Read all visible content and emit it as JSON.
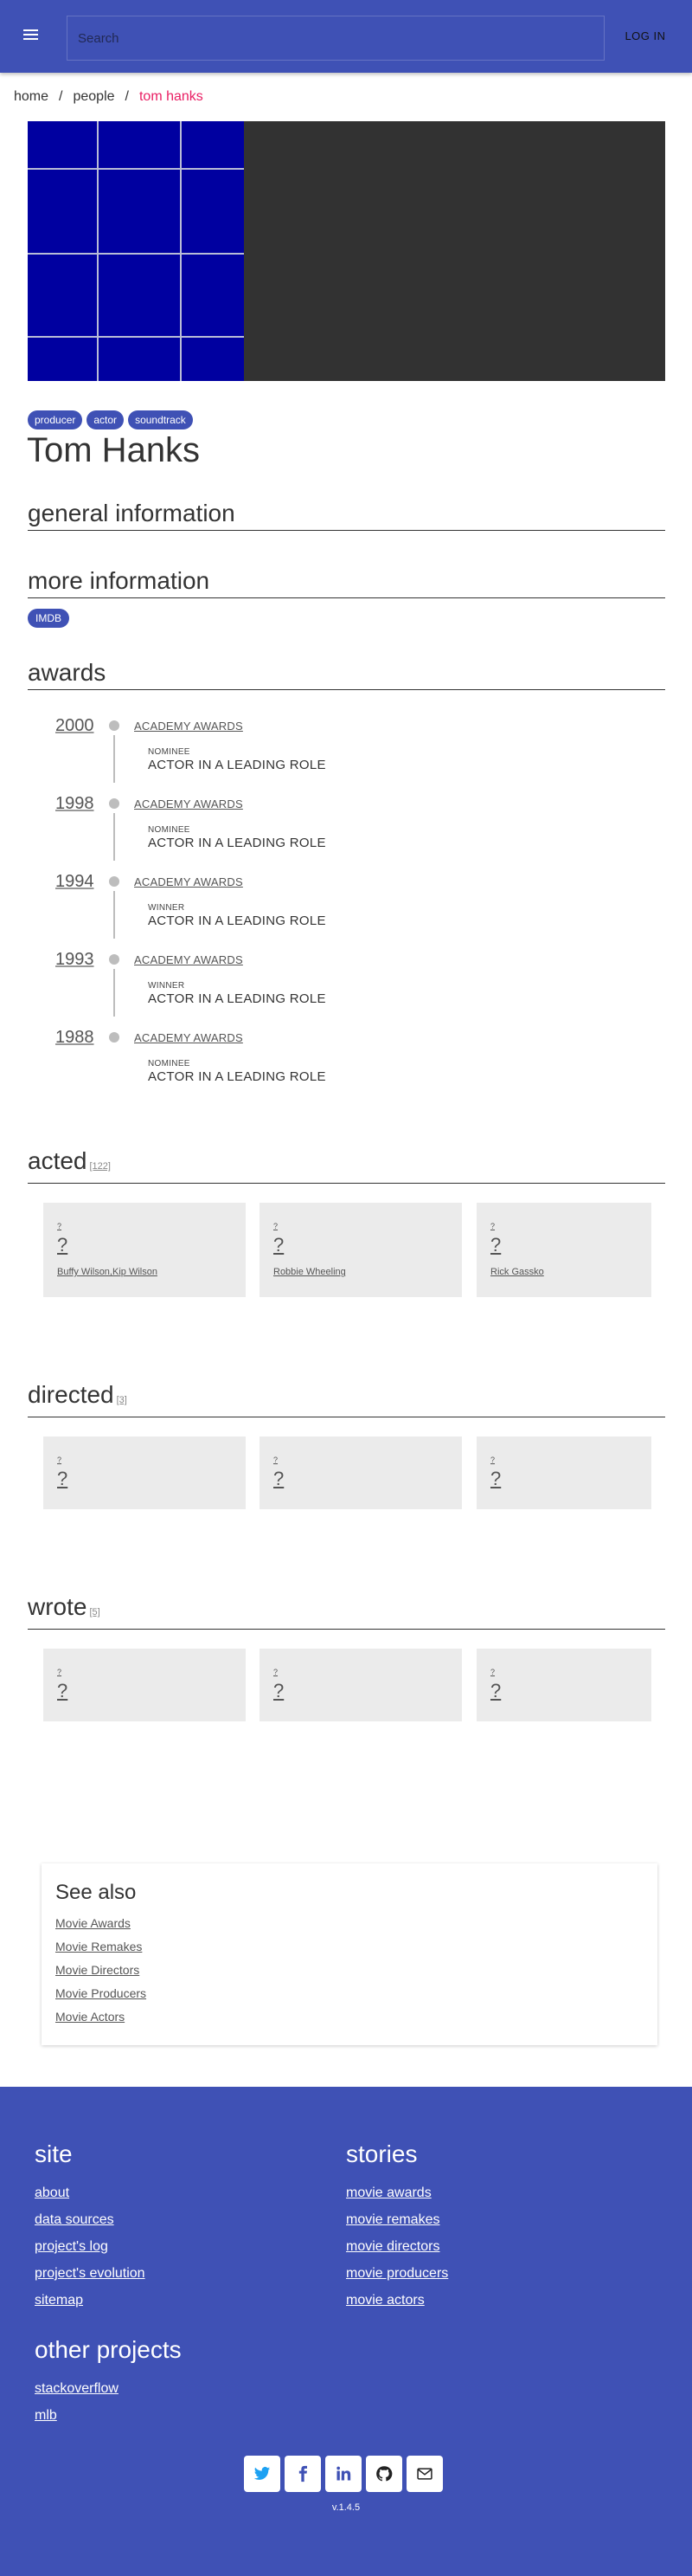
{
  "header": {
    "search_placeholder": "Search",
    "login_label": "LOG IN",
    "primary_color": "#3f51b5"
  },
  "breadcrumb": {
    "home": "home",
    "people": "people",
    "current": "tom hanks",
    "separator": "/",
    "current_color": "#e91e63"
  },
  "person": {
    "roles": [
      "producer",
      "actor",
      "soundtrack"
    ],
    "name": "Tom Hanks"
  },
  "sections": {
    "general": "general information",
    "more": "more information",
    "awards": "awards",
    "acted": "acted",
    "acted_count": "[122]",
    "directed": "directed",
    "directed_count": "[3]",
    "wrote": "wrote",
    "wrote_count": "[5]"
  },
  "more_info": {
    "imdb_label": "IMDB"
  },
  "awards": [
    {
      "year": "2000",
      "org": "ACADEMY AWARDS",
      "status": "NOMINEE",
      "category": "ACTOR IN A LEADING ROLE"
    },
    {
      "year": "1998",
      "org": "ACADEMY AWARDS",
      "status": "NOMINEE",
      "category": "ACTOR IN A LEADING ROLE"
    },
    {
      "year": "1994",
      "org": "ACADEMY AWARDS",
      "status": "WINNER",
      "category": "ACTOR IN A LEADING ROLE"
    },
    {
      "year": "1993",
      "org": "ACADEMY AWARDS",
      "status": "WINNER",
      "category": "ACTOR IN A LEADING ROLE"
    },
    {
      "year": "1988",
      "org": "ACADEMY AWARDS",
      "status": "NOMINEE",
      "category": "ACTOR IN A LEADING ROLE"
    }
  ],
  "acted": [
    {
      "small": "?",
      "big": "?",
      "role": "Buffy Wilson,Kip Wilson"
    },
    {
      "small": "?",
      "big": "?",
      "role": "Robbie Wheeling"
    },
    {
      "small": "?",
      "big": "?",
      "role": "Rick Gassko"
    }
  ],
  "directed": [
    {
      "small": "?",
      "big": "?"
    },
    {
      "small": "?",
      "big": "?"
    },
    {
      "small": "?",
      "big": "?"
    }
  ],
  "wrote": [
    {
      "small": "?",
      "big": "?"
    },
    {
      "small": "?",
      "big": "?"
    },
    {
      "small": "?",
      "big": "?"
    }
  ],
  "see_also": {
    "title": "See also",
    "links": [
      "Movie Awards",
      "Movie Remakes",
      "Movie Directors",
      "Movie Producers",
      "Movie Actors"
    ]
  },
  "footer": {
    "site_title": "site",
    "site_links": [
      "about",
      "data sources",
      "project's log",
      "project's evolution",
      "sitemap"
    ],
    "stories_title": "stories",
    "stories_links": [
      "movie awards",
      "movie remakes",
      "movie directors",
      "movie producers",
      "movie actors"
    ],
    "other_title": "other projects",
    "other_links": [
      "stackoverflow",
      "mlb"
    ],
    "social_icons": [
      "twitter-icon",
      "facebook-icon",
      "linkedin-icon",
      "github-icon",
      "email-icon"
    ],
    "version": "v.1.4.5"
  }
}
